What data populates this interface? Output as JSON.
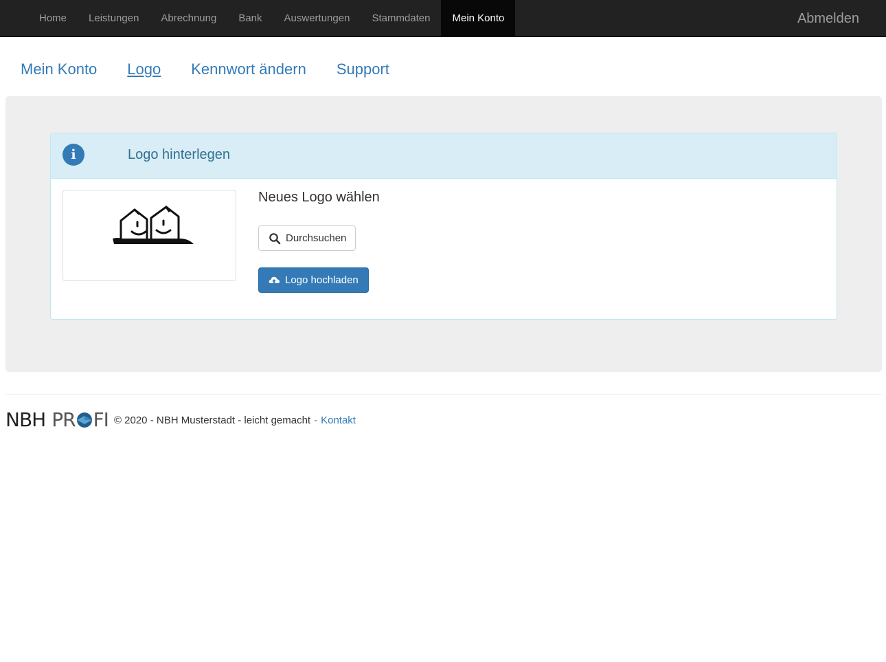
{
  "navbar": {
    "items": [
      {
        "label": "Home"
      },
      {
        "label": "Leistungen"
      },
      {
        "label": "Abrechnung"
      },
      {
        "label": "Bank"
      },
      {
        "label": "Auswertungen"
      },
      {
        "label": "Stammdaten"
      },
      {
        "label": "Mein Konto",
        "active": true
      }
    ],
    "logout_label": "Abmelden"
  },
  "subnav": {
    "items": [
      {
        "label": "Mein Konto"
      },
      {
        "label": "Logo",
        "current": true
      },
      {
        "label": "Kennwort ändern"
      },
      {
        "label": "Support"
      }
    ]
  },
  "panel": {
    "icon": "info-icon",
    "icon_glyph": "i",
    "title": "Logo hinterlegen",
    "choose_heading": "Neues Logo wählen",
    "browse_label": "Durchsuchen",
    "browse_icon": "search-icon",
    "upload_label": "Logo hochladen",
    "upload_icon": "cloud-upload-icon"
  },
  "footer": {
    "brand_left": "NBH",
    "brand_right_1": "PR",
    "brand_right_2": "FI",
    "text": "© 2020 - NBH Musterstadt - leicht gemacht",
    "separator": "-",
    "link_label": "Kontakt"
  },
  "colors": {
    "navbar_bg": "#222222",
    "navbar_active_bg": "#080808",
    "link_blue": "#337ab7",
    "panel_heading_bg": "#d9edf7",
    "well_bg": "#eeeeee"
  }
}
